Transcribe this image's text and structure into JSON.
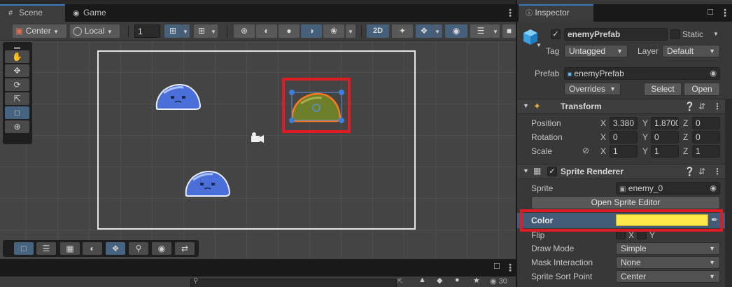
{
  "scene": {
    "tabs": [
      {
        "label": "Scene",
        "icon": "grid-icon"
      },
      {
        "label": "Game",
        "icon": "gamepad-icon"
      }
    ],
    "toolbar": {
      "pivot_mode": "Center",
      "pivot_rotation": "Local",
      "grid_snap_value": "1",
      "mode_2d": "2D"
    },
    "object_count": "30"
  },
  "inspector": {
    "tab_label": "Inspector",
    "object_name": "enemyPrefab",
    "static_label": "Static",
    "tag_label": "Tag",
    "tag_value": "Untagged",
    "layer_label": "Layer",
    "layer_value": "Default",
    "prefab_label": "Prefab",
    "prefab_value": "enemyPrefab",
    "overrides_label": "Overrides",
    "select_label": "Select",
    "open_label": "Open",
    "transform": {
      "title": "Transform",
      "position_label": "Position",
      "position": {
        "x": "3.380",
        "y": "1.8700",
        "z": "0"
      },
      "rotation_label": "Rotation",
      "rotation": {
        "x": "0",
        "y": "0",
        "z": "0"
      },
      "scale_label": "Scale",
      "scale": {
        "x": "1",
        "y": "1",
        "z": "1"
      }
    },
    "sprite_renderer": {
      "title": "Sprite Renderer",
      "sprite_label": "Sprite",
      "sprite_value": "enemy_0",
      "open_editor_label": "Open Sprite Editor",
      "color_label": "Color",
      "color_value": "#ffe94a",
      "flip_label": "Flip",
      "flip_x": "X",
      "flip_y": "Y",
      "draw_mode_label": "Draw Mode",
      "draw_mode_value": "Simple",
      "mask_label": "Mask Interaction",
      "mask_value": "None",
      "sort_point_label": "Sprite Sort Point",
      "sort_point_value": "Center"
    }
  }
}
